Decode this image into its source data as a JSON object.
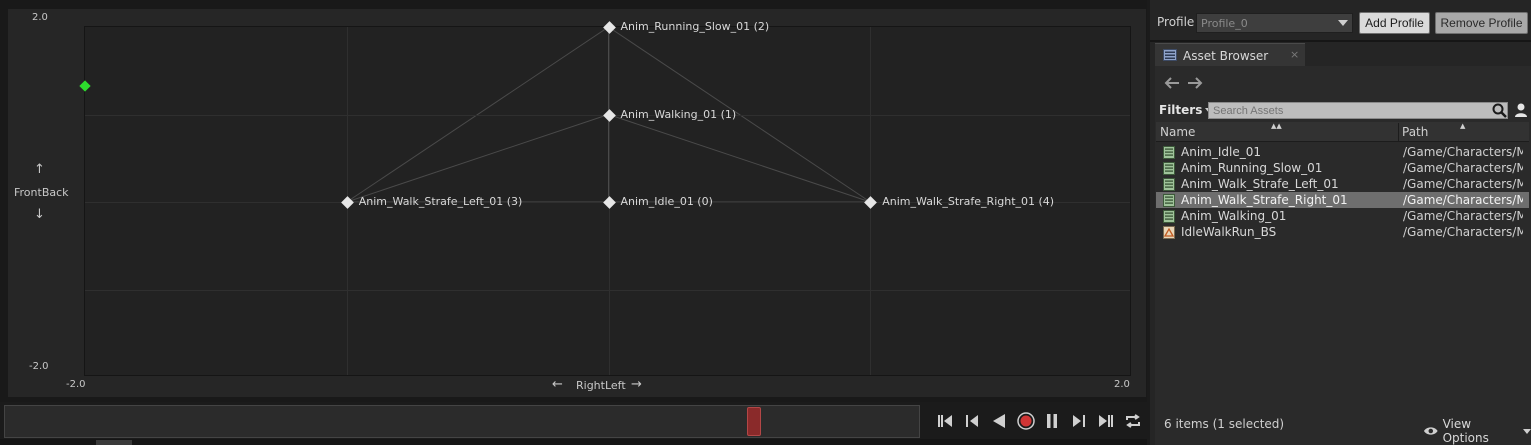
{
  "graph": {
    "y_max_label": "2.0",
    "y_min_label": "-2.0",
    "x_min_label": "-2.0",
    "x_max_label": "2.0",
    "y_axis_name": "FrontBack",
    "x_axis_name": "RightLeft",
    "arrow_up": "↑",
    "arrow_down": "↓",
    "arrow_left": "←",
    "arrow_right": "→",
    "samples": [
      {
        "label": "Anim_Running_Slow_01 (2)",
        "x": 0,
        "y": 2
      },
      {
        "label": "Anim_Walking_01 (1)",
        "x": 0,
        "y": 1
      },
      {
        "label": "Anim_Walk_Strafe_Left_01 (3)",
        "x": -1,
        "y": 0
      },
      {
        "label": "Anim_Idle_01 (0)",
        "x": 0,
        "y": 0
      },
      {
        "label": "Anim_Walk_Strafe_Right_01 (4)",
        "x": 1,
        "y": 0
      }
    ],
    "triangles": [
      [
        2,
        1,
        3
      ],
      [
        1,
        3,
        4
      ],
      [
        0,
        1,
        4
      ],
      [
        0,
        2,
        1
      ]
    ],
    "preview_point": {
      "x": -2,
      "y": 1.33
    },
    "tool_icons": [
      "triangulation-icon",
      "tag-icon",
      "move-icon"
    ]
  },
  "timeline": {
    "scrub_fraction": 0.818
  },
  "transport": {
    "buttons": [
      "skip-to-start-icon",
      "step-back-icon",
      "play-reverse-icon",
      "record-icon",
      "pause-icon",
      "step-forward-icon",
      "skip-to-end-icon",
      "loop-icon"
    ],
    "accent": "#e04040"
  },
  "profile": {
    "label": "Profile",
    "value": "Profile_0",
    "add_label": "Add Profile",
    "remove_label": "Remove Profile"
  },
  "asset_browser": {
    "tab_label": "Asset Browser",
    "close_glyph": "×",
    "filters_label": "Filters",
    "search_placeholder": "Search Assets",
    "col_name": "Name",
    "col_path": "Path",
    "items": [
      {
        "name": "Anim_Idle_01",
        "path": "/Game/Characters/Mi:",
        "selected": false,
        "icon": "animation-asset-icon"
      },
      {
        "name": "Anim_Running_Slow_01",
        "path": "/Game/Characters/Mi:",
        "selected": false,
        "icon": "animation-asset-icon"
      },
      {
        "name": "Anim_Walk_Strafe_Left_01",
        "path": "/Game/Characters/Mi:",
        "selected": false,
        "icon": "animation-asset-icon"
      },
      {
        "name": "Anim_Walk_Strafe_Right_01",
        "path": "/Game/Characters/Mi:",
        "selected": true,
        "icon": "animation-asset-icon"
      },
      {
        "name": "Anim_Walking_01",
        "path": "/Game/Characters/Mi:",
        "selected": false,
        "icon": "animation-asset-icon"
      },
      {
        "name": "IdleWalkRun_BS",
        "path": "/Game/Characters/Mi:",
        "selected": false,
        "icon": "blendspace-asset-icon"
      }
    ],
    "status": "6 items (1 selected)",
    "view_options_label": "View Options"
  },
  "colors": {
    "tool_button": "#c8941c",
    "preview_point": "#2ddc2d",
    "scrub_handle": "#8a2a2a"
  }
}
